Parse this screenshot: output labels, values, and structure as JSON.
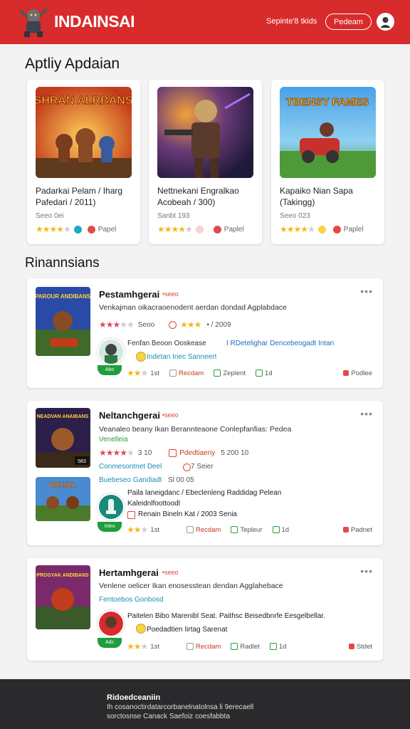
{
  "header": {
    "brand": "INDAINSAI",
    "link": "Sepinte'8 tkids",
    "button": "Pedeam"
  },
  "featured": {
    "title": "Aptliy Apdaian",
    "cards": [
      {
        "title": "Padarkai Pelam / Iharg Pafedari / 2011)",
        "meta": "Seeo 0ei",
        "action": "Papel",
        "art_text": "SHRAN ALRBANS"
      },
      {
        "title": "Nettnekani Engralkao Acobeah / 300)",
        "meta": "Sanbt 193",
        "action": "Paplel",
        "art_text": ""
      },
      {
        "title": "Kapaiko Nian Sapa (Takingg)",
        "meta": "Seeo 023",
        "action": "Paplel",
        "art_text": "TBENSY FAMES"
      }
    ]
  },
  "list": {
    "title": "Rinannsians",
    "items": [
      {
        "name": "Pestamhgerai",
        "tag": "•seeo",
        "desc": "Venkajman oikacraoenodent aerdan dondad Agplabdace",
        "rating_text": "Seoo",
        "rating2": "• / 2009",
        "sub_title": "Fenfan Beoon Ooskease",
        "sub_link": "I RDetelighar Dencebeogadt Intan",
        "sub2": "Indetan Inec Sanneert",
        "green_badge": "Abo",
        "foot": [
          "1st",
          "Recdam",
          "Zeplent",
          "1d",
          "Podlee"
        ],
        "art_text": "PAROUR ANDIBANS"
      },
      {
        "name": "Neltanchgerai",
        "tag": "•seeo",
        "desc": "Veanaleo beany Ikan Berannteaone Conlepfanfias: Pedea",
        "sub_green": "Venelleia",
        "rating_text": "3 10",
        "rating2": "Pdedtiaeny",
        "rating3": "5 200 10",
        "sub_blue": "Conmesontnet Deel",
        "sub_blue2": "7 Seier",
        "sub_blue3": "Buebeseo Gandiadt",
        "sub_blue4": "Sl 00 05",
        "desc2": "Paila laneigdanc / Ebeclenleng Raddidag Pelean",
        "desc3": "Kaleidnlfoottoodl",
        "desc4": "Renain Bineln Kat / 2003 Senia",
        "green_badge": "Inleo",
        "badge_thumb": "583",
        "foot": [
          "1st",
          "Recdam",
          "Tepleur",
          "1d",
          "Padnet"
        ],
        "art_text": "NEADVAN ANAIBANS",
        "art_text2": "WALVAL"
      },
      {
        "name": "Hertamhgerai",
        "tag": "•seeo",
        "desc": "Venlene oelicer Ikan enosesstean dendan Agglahebace",
        "sub_blue": "Fentoebos Gonbosd",
        "desc2": "Paitelen Bibo Marenibl Seat. Paithsc Beisedbnrfe Eesgelbellar.",
        "desc3": "Poedadtien Iirtag Sarenat",
        "green_badge": "Adc",
        "foot": [
          "1st",
          "Recdam",
          "Radlet",
          "1d",
          "Stdet"
        ],
        "art_text": "PROGYAK ANDIBANS"
      }
    ]
  },
  "footer": {
    "title": "Ridoedceaniin",
    "line1": "Ih cosanoctirdatarcorbanelnatolnsa li 9erecaell",
    "line2": "sorctosnse Canack Saefoiz coesfabbta"
  },
  "colors": {
    "brand_red": "#d82b2b",
    "star": "#f3b81a",
    "green": "#1e9e3c",
    "footer": "#2a2a2c"
  }
}
